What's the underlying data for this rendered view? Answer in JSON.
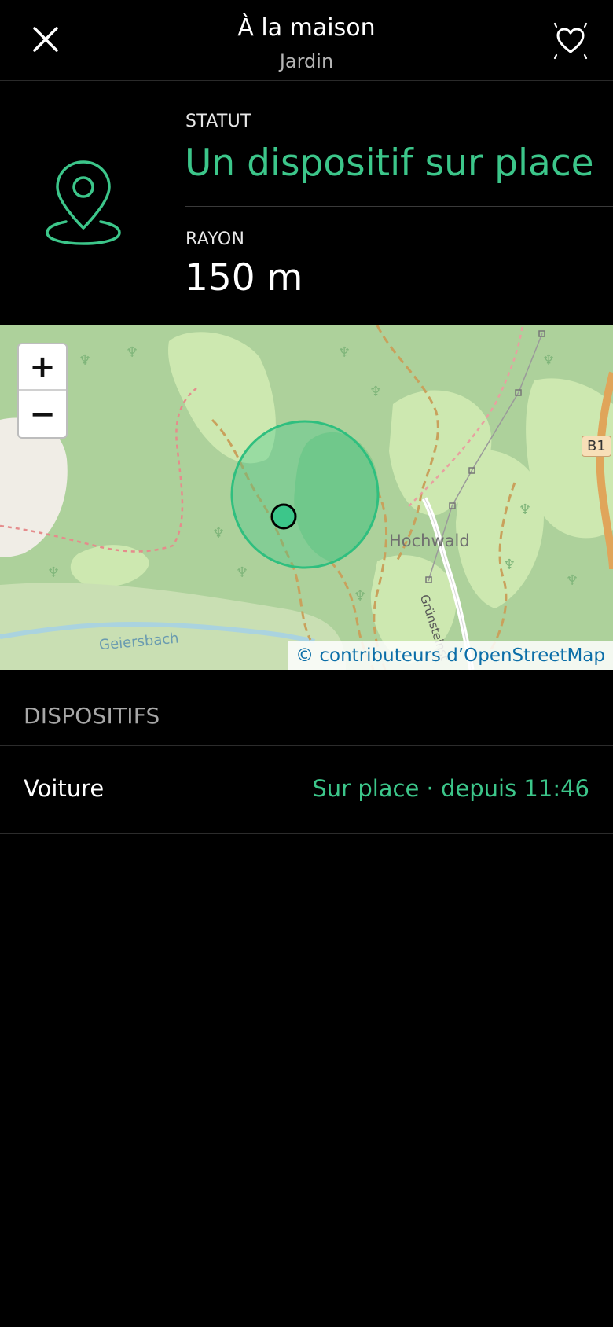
{
  "header": {
    "title": "À la maison",
    "subtitle": "Jardin",
    "close_icon": "close-icon",
    "favorite_icon": "heart-icon"
  },
  "info": {
    "status_label": "STATUT",
    "status_value": "Un dispositif sur place",
    "radius_label": "RAYON",
    "radius_value": "150 m",
    "icon": "location-pin-icon",
    "accent_color": "#3cc68a"
  },
  "map": {
    "zoom_in": "+",
    "zoom_out": "−",
    "attribution": "© contributeurs d’OpenStreetMap",
    "labels": {
      "hochwald": "Hochwald",
      "geiersbach": "Geiersbach",
      "road": "B1",
      "street": "Grünsteinst"
    }
  },
  "devices": {
    "section_title": "DISPOSITIFS",
    "items": [
      {
        "name": "Voiture",
        "status": "Sur place · depuis 11:46"
      }
    ]
  }
}
